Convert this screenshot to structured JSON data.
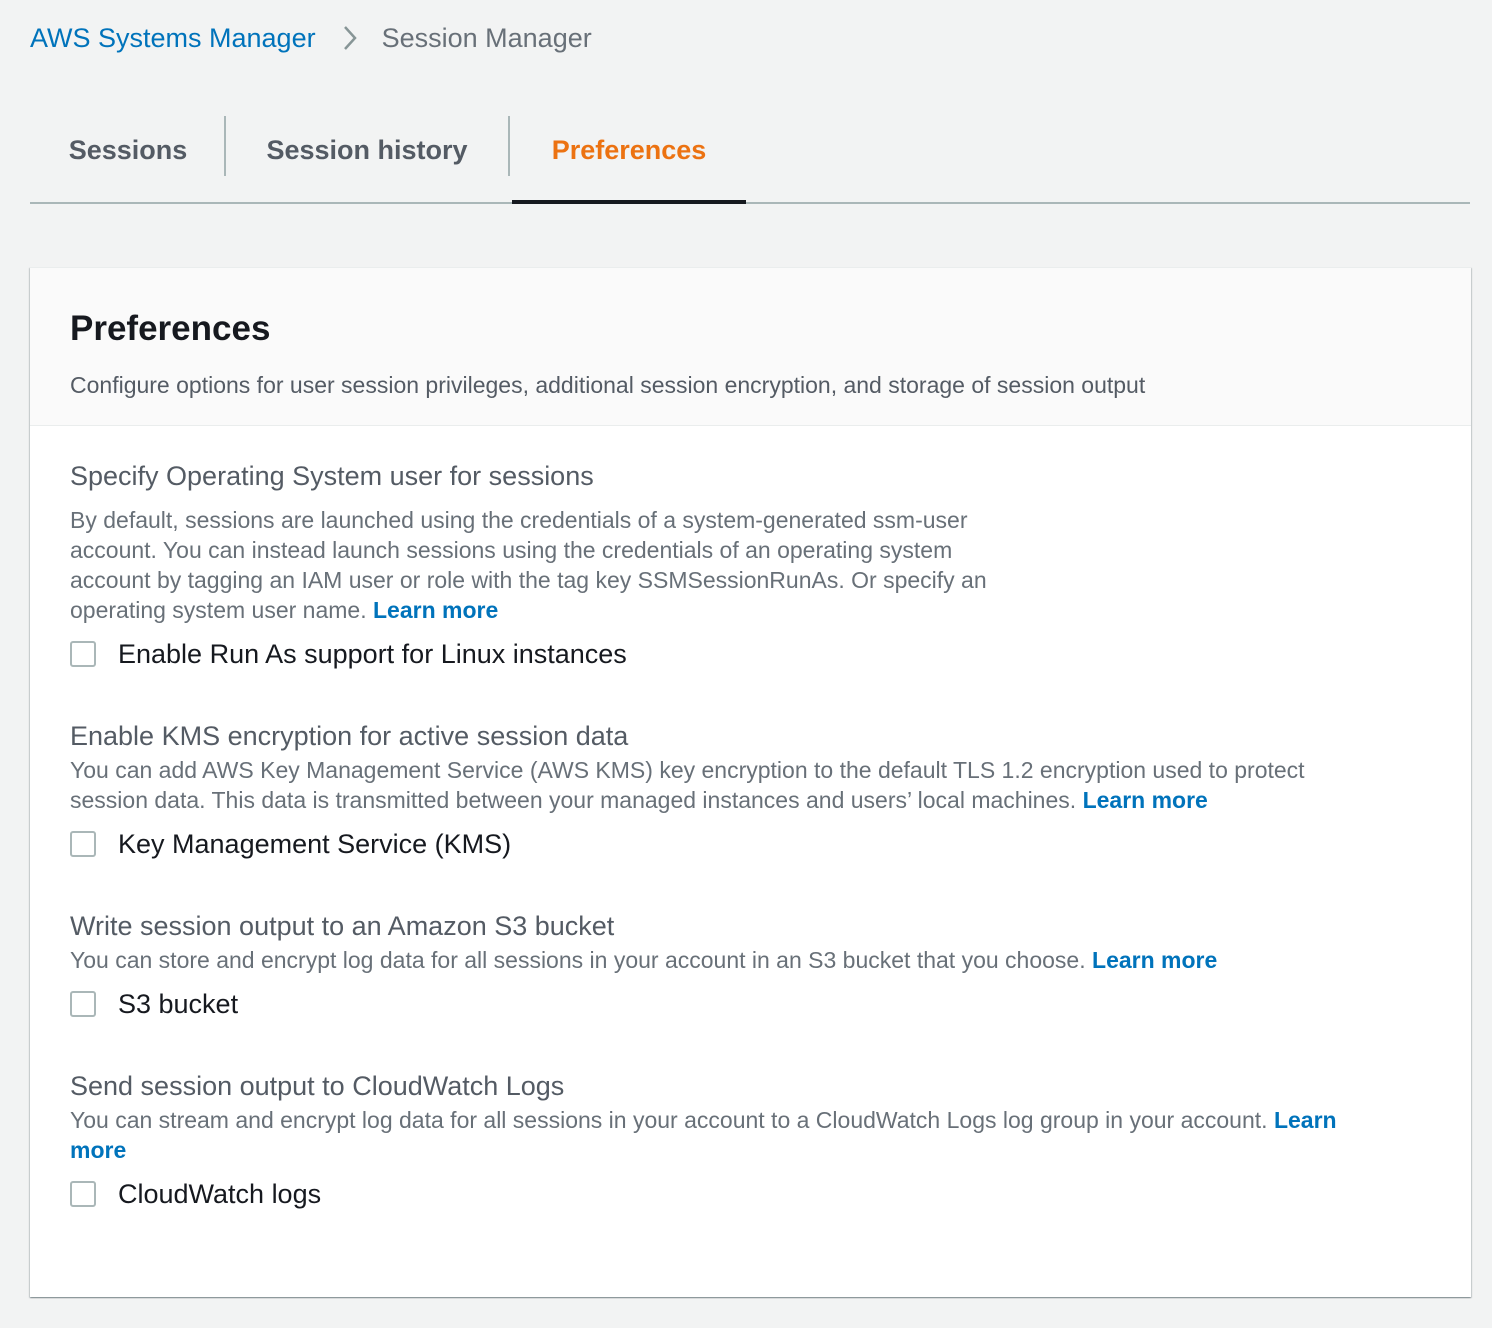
{
  "breadcrumb": {
    "parent": "AWS Systems Manager",
    "current": "Session Manager",
    "separator_icon": "chevron-right-icon"
  },
  "tabs": [
    {
      "label": "Sessions",
      "active": false
    },
    {
      "label": "Session history",
      "active": false
    },
    {
      "label": "Preferences",
      "active": true
    }
  ],
  "colors": {
    "link": "#0073bb",
    "active_tab": "#ec7211",
    "background": "#f2f3f3"
  },
  "panel": {
    "title": "Preferences",
    "description": "Configure options for user session privileges, additional session encryption, and storage of session output"
  },
  "sections": [
    {
      "label": "Specify Operating System user for sessions",
      "desc_lines": [
        "By default, sessions are launched using the credentials of a system-generated ssm-user",
        "account. You can instead launch sessions using the credentials of an operating system",
        "account by tagging an IAM user or role with the tag key SSMSessionRunAs. Or specify an",
        "operating system user name."
      ],
      "learn_more": "Learn more",
      "checkbox_label": "Enable Run As support for Linux instances",
      "checked": false
    },
    {
      "label": "Enable KMS encryption for active session data",
      "desc_lines": [
        "You can add AWS Key Management Service (AWS KMS) key encryption to the default TLS 1.2 encryption used to protect",
        "session data. This data is transmitted between your managed instances and users’ local machines."
      ],
      "learn_more": "Learn more",
      "checkbox_label": "Key Management Service (KMS)",
      "checked": false
    },
    {
      "label": "Write session output to an Amazon S3 bucket",
      "desc_lines": [
        "You can store and encrypt log data for all sessions in your account in an S3 bucket that you choose."
      ],
      "learn_more": "Learn more",
      "checkbox_label": "S3 bucket",
      "checked": false
    },
    {
      "label": "Send session output to CloudWatch Logs",
      "desc_lines": [
        "You can stream and encrypt log data for all sessions in your account to a CloudWatch Logs log group in your account."
      ],
      "learn_more_line1": "Learn",
      "learn_more_line2": "more",
      "checkbox_label": "CloudWatch logs",
      "checked": false
    }
  ]
}
